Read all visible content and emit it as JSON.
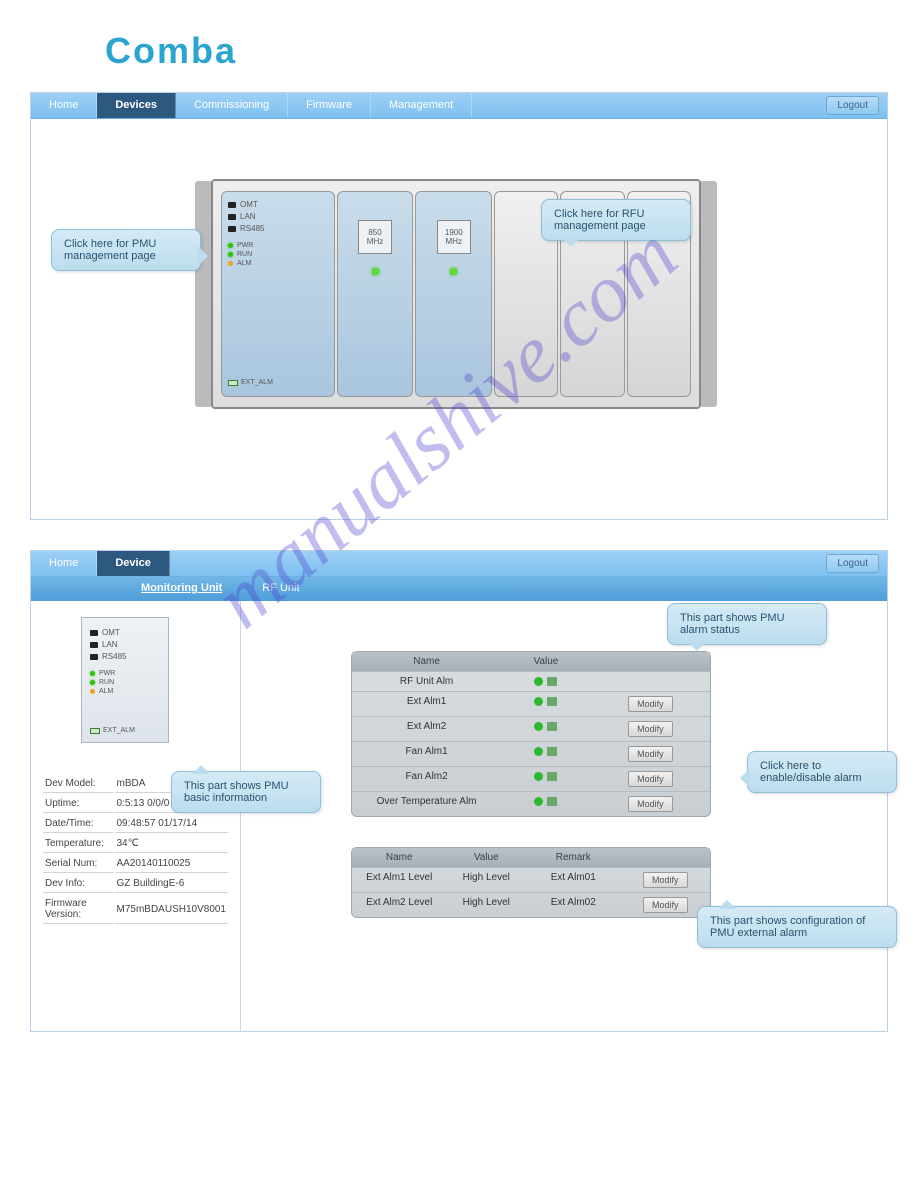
{
  "brand": "Comba",
  "watermark": "manualshive.com",
  "panel1": {
    "nav": [
      "Home",
      "Devices",
      "Commissioning",
      "Firmware",
      "Management"
    ],
    "nav_active": "Devices",
    "logout": "Logout",
    "pmu": {
      "ports": [
        "OMT",
        "LAN",
        "RS485"
      ],
      "leds": [
        {
          "label": "PWR",
          "cls": "g"
        },
        {
          "label": "RUN",
          "cls": "g"
        },
        {
          "label": "ALM",
          "cls": "o"
        }
      ],
      "extalm": "EXT_ALM"
    },
    "rf": [
      {
        "f": "850",
        "u": "MHz"
      },
      {
        "f": "1900",
        "u": "MHz"
      }
    ],
    "callout_pmu": "Click here for PMU management page",
    "callout_rfu": "Click here for RFU management page"
  },
  "panel2": {
    "nav": [
      "Home",
      "Device"
    ],
    "nav_active": "Device",
    "logout": "Logout",
    "subnav": [
      "Monitoring Unit",
      "RF Unit"
    ],
    "subnav_active": "Monitoring Unit",
    "pmu": {
      "ports": [
        "OMT",
        "LAN",
        "RS485"
      ],
      "leds": [
        {
          "label": "PWR",
          "cls": "g"
        },
        {
          "label": "RUN",
          "cls": "g"
        },
        {
          "label": "ALM",
          "cls": "o"
        }
      ],
      "extalm": "EXT_ALM"
    },
    "info": [
      {
        "k": "Dev Model:",
        "v": "mBDA"
      },
      {
        "k": "Uptime:",
        "v": "0:5:13 0/0/0"
      },
      {
        "k": "Date/Time:",
        "v": "09:48:57 01/17/14"
      },
      {
        "k": "Temperature:",
        "v": "34℃"
      },
      {
        "k": "Serial Num:",
        "v": "AA20140110025"
      },
      {
        "k": "Dev Info:",
        "v": "GZ BuildingE-6"
      },
      {
        "k": "Firmware Version:",
        "v": "M75mBDAUSH10V8001"
      }
    ],
    "alarm_head": {
      "name": "Name",
      "value": "Value"
    },
    "alarm_rows": [
      {
        "name": "RF Unit Alm",
        "modify": false
      },
      {
        "name": "Ext Alm1",
        "modify": true
      },
      {
        "name": "Ext Alm2",
        "modify": true
      },
      {
        "name": "Fan Alm1",
        "modify": true
      },
      {
        "name": "Fan Alm2",
        "modify": true
      },
      {
        "name": "Over Temperature Alm",
        "modify": true
      }
    ],
    "cfg_head": {
      "name": "Name",
      "value": "Value",
      "remark": "Remark"
    },
    "cfg_rows": [
      {
        "name": "Ext Alm1 Level",
        "value": "High Level",
        "remark": "Ext Alm01"
      },
      {
        "name": "Ext Alm2 Level",
        "value": "High Level",
        "remark": "Ext Alm02"
      }
    ],
    "modify_label": "Modify",
    "callout_alarm": "This part shows PMU alarm status",
    "callout_basic": "This part shows PMU basic information",
    "callout_enable": "Click here to enable/disable alarm",
    "callout_cfg": "This part shows configuration of PMU external alarm"
  }
}
